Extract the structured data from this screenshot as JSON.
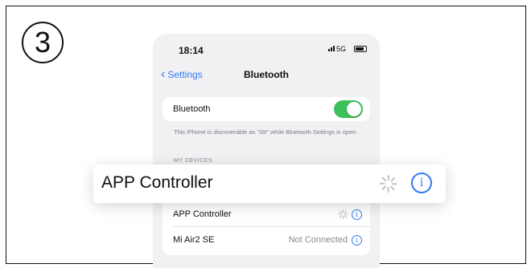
{
  "step_number": "3",
  "status_bar": {
    "time": "18:14",
    "network": "5G"
  },
  "nav": {
    "back_label": "Settings",
    "title": "Bluetooth"
  },
  "bluetooth_cell": {
    "label": "Bluetooth",
    "toggle_on": true
  },
  "footnote": "This iPhone is discoverable as \"Stt\" while Bluetooth Settings is open.",
  "section_header": "MY DEVICES",
  "devices": [
    {
      "name": "APP Controller",
      "status": "",
      "connecting": true
    },
    {
      "name": "Mi Air2 SE",
      "status": "Not Connected",
      "connecting": false
    }
  ],
  "highlight": {
    "name": "APP Controller"
  },
  "icons": {
    "info": "i",
    "toggle_color": "#3dc05a",
    "accent": "#2f7cf6"
  }
}
